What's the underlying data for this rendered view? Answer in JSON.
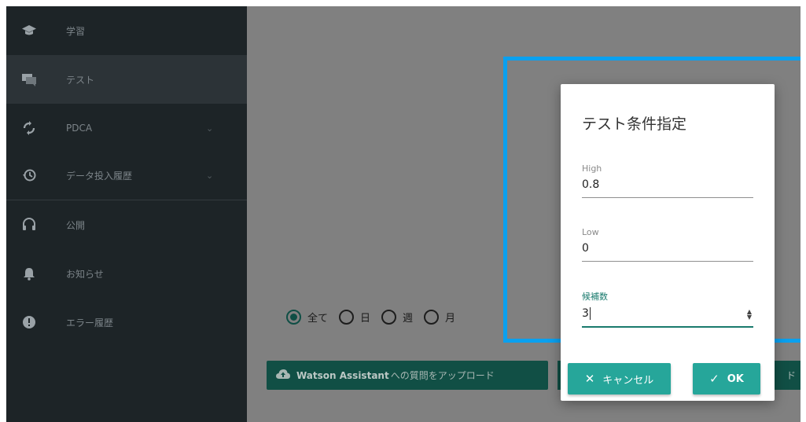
{
  "sidebar": {
    "items": [
      {
        "label": "学習",
        "icon": "graduation-cap-icon",
        "active": false,
        "expandable": false
      },
      {
        "label": "テスト",
        "icon": "chat-bubbles-icon",
        "active": true,
        "expandable": false
      },
      {
        "label": "PDCA",
        "icon": "cycle-arrows-icon",
        "active": false,
        "expandable": true
      },
      {
        "label": "データ投入履歴",
        "icon": "history-icon",
        "active": false,
        "expandable": true
      },
      {
        "label": "公開",
        "icon": "headset-icon",
        "active": false,
        "expandable": false
      },
      {
        "label": "お知らせ",
        "icon": "bell-icon",
        "active": false,
        "expandable": false
      },
      {
        "label": "エラー履歴",
        "icon": "alert-circle-icon",
        "active": false,
        "expandable": false
      }
    ]
  },
  "main": {
    "period_filter": {
      "selected": "全て",
      "options": [
        "全て",
        "日",
        "週",
        "月"
      ]
    },
    "upload_button": {
      "bold": "Watson Assistant",
      "rest": "への質問をアップロード",
      "icon": "cloud-upload-icon"
    },
    "side_button_fragment": "ド"
  },
  "dialog": {
    "title": "テスト条件指定",
    "fields": {
      "high": {
        "label": "High",
        "value": "0.8"
      },
      "low": {
        "label": "Low",
        "value": "0"
      },
      "candidates": {
        "label": "候補数",
        "value": "3"
      }
    },
    "cancel_label": "キャンセル",
    "ok_label": "OK",
    "cancel_icon": "close-icon",
    "ok_icon": "check-icon"
  },
  "colors": {
    "sidebar_bg": "#1d2427",
    "overlay_bg": "#808080",
    "primary_button": "#26a69a",
    "highlight_border": "#0aa0ef",
    "focus_accent": "#197a6d"
  }
}
